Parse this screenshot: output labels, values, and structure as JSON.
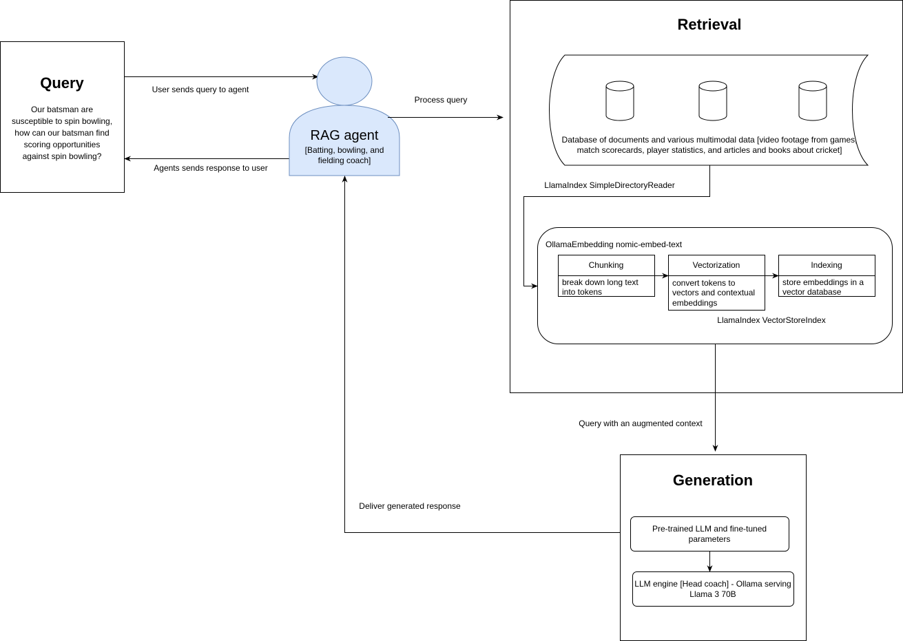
{
  "query": {
    "title": "Query",
    "body": [
      "Our batsman are",
      "susceptible to spin bowling,",
      "how can our batsman find",
      "scoring opportunities",
      "against spin bowling?"
    ]
  },
  "agent": {
    "title": "RAG agent",
    "subtitle": [
      "[Batting, bowling, and",
      "fielding coach]"
    ],
    "fill": "#dae8fc",
    "stroke": "#6c8ebf"
  },
  "edges": {
    "user_to_agent": "User sends query to agent",
    "agent_to_user": "Agents sends response to user",
    "process_query": "Process query",
    "directory_reader": "LlamaIndex SimpleDirectoryReader",
    "augmented_context": "Query with an augmented context",
    "deliver_response": "Deliver generated response"
  },
  "retrieval": {
    "title": "Retrieval",
    "database_text": [
      "Database of documents and various multimodal data [video footage from games,",
      "match scorecards, player statistics, and articles and books about cricket]"
    ],
    "embedding_label": "OllamaEmbedding nomic-embed-text",
    "index_label": "LlamaIndex VectorStoreIndex",
    "steps": [
      {
        "title": "Chunking",
        "body": [
          "break down long text",
          "into tokens"
        ]
      },
      {
        "title": "Vectorization",
        "body": [
          "convert tokens to",
          "vectors and contextual",
          "embeddings"
        ]
      },
      {
        "title": "Indexing",
        "body": [
          "store embeddings in a",
          "vector database"
        ]
      }
    ]
  },
  "generation": {
    "title": "Generation",
    "llm_params": [
      "Pre-trained LLM and fine-tuned",
      "parameters"
    ],
    "llm_engine": [
      "LLM engine [Head coach] - Ollama serving",
      "Llama 3 70B"
    ]
  }
}
